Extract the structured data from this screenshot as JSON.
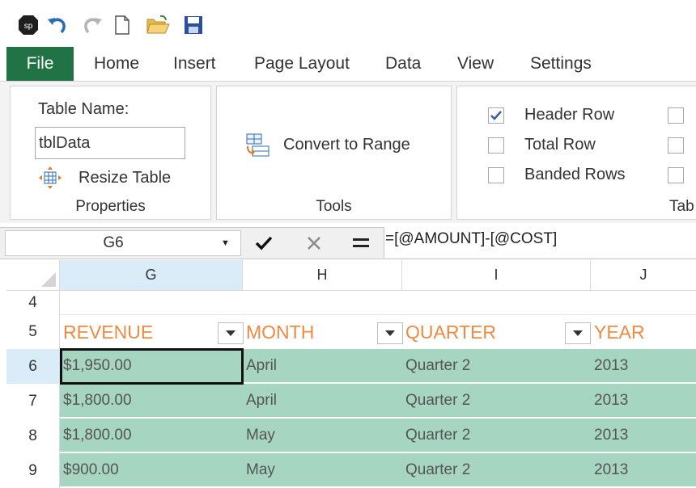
{
  "app": {
    "logo_text": "sp"
  },
  "qat": {
    "icons": [
      "app-logo-icon",
      "undo-icon",
      "redo-icon",
      "new-document-icon",
      "open-folder-icon",
      "save-icon"
    ]
  },
  "tabs": {
    "file": "File",
    "home": "Home",
    "insert": "Insert",
    "page_layout": "Page Layout",
    "data": "Data",
    "view": "View",
    "settings": "Settings"
  },
  "ribbon": {
    "properties": {
      "table_name_label": "Table Name:",
      "table_name_value": "tblData",
      "resize_label": "Resize Table",
      "group_label": "Properties"
    },
    "tools": {
      "convert_label": "Convert to Range",
      "group_label": "Tools"
    },
    "style_options": {
      "header_row": "Header Row",
      "header_row_checked": true,
      "total_row": "Total Row",
      "total_row_checked": false,
      "banded_rows": "Banded Rows",
      "banded_rows_checked": false,
      "group_label_partial": "Tab"
    }
  },
  "formula_bar": {
    "name_box": "G6",
    "formula": "=[@AMOUNT]-[@COST]"
  },
  "colors": {
    "accent": "#217346",
    "band": "#a6d5c1",
    "header_text": "#ef8a42",
    "selected_header": "#d9ecf7"
  },
  "grid": {
    "columns": [
      "G",
      "H",
      "I",
      "J"
    ],
    "rows": [
      "4",
      "5",
      "6",
      "7",
      "8",
      "9"
    ],
    "headers": [
      "REVENUE",
      "MONTH",
      "QUARTER",
      "YEAR"
    ],
    "data": [
      [
        "$1,950.00",
        "April",
        "Quarter 2",
        "2013"
      ],
      [
        "$1,800.00",
        "April",
        "Quarter 2",
        "2013"
      ],
      [
        "$1,800.00",
        "May",
        "Quarter 2",
        "2013"
      ],
      [
        "$900.00",
        "May",
        "Quarter 2",
        "2013"
      ]
    ]
  }
}
